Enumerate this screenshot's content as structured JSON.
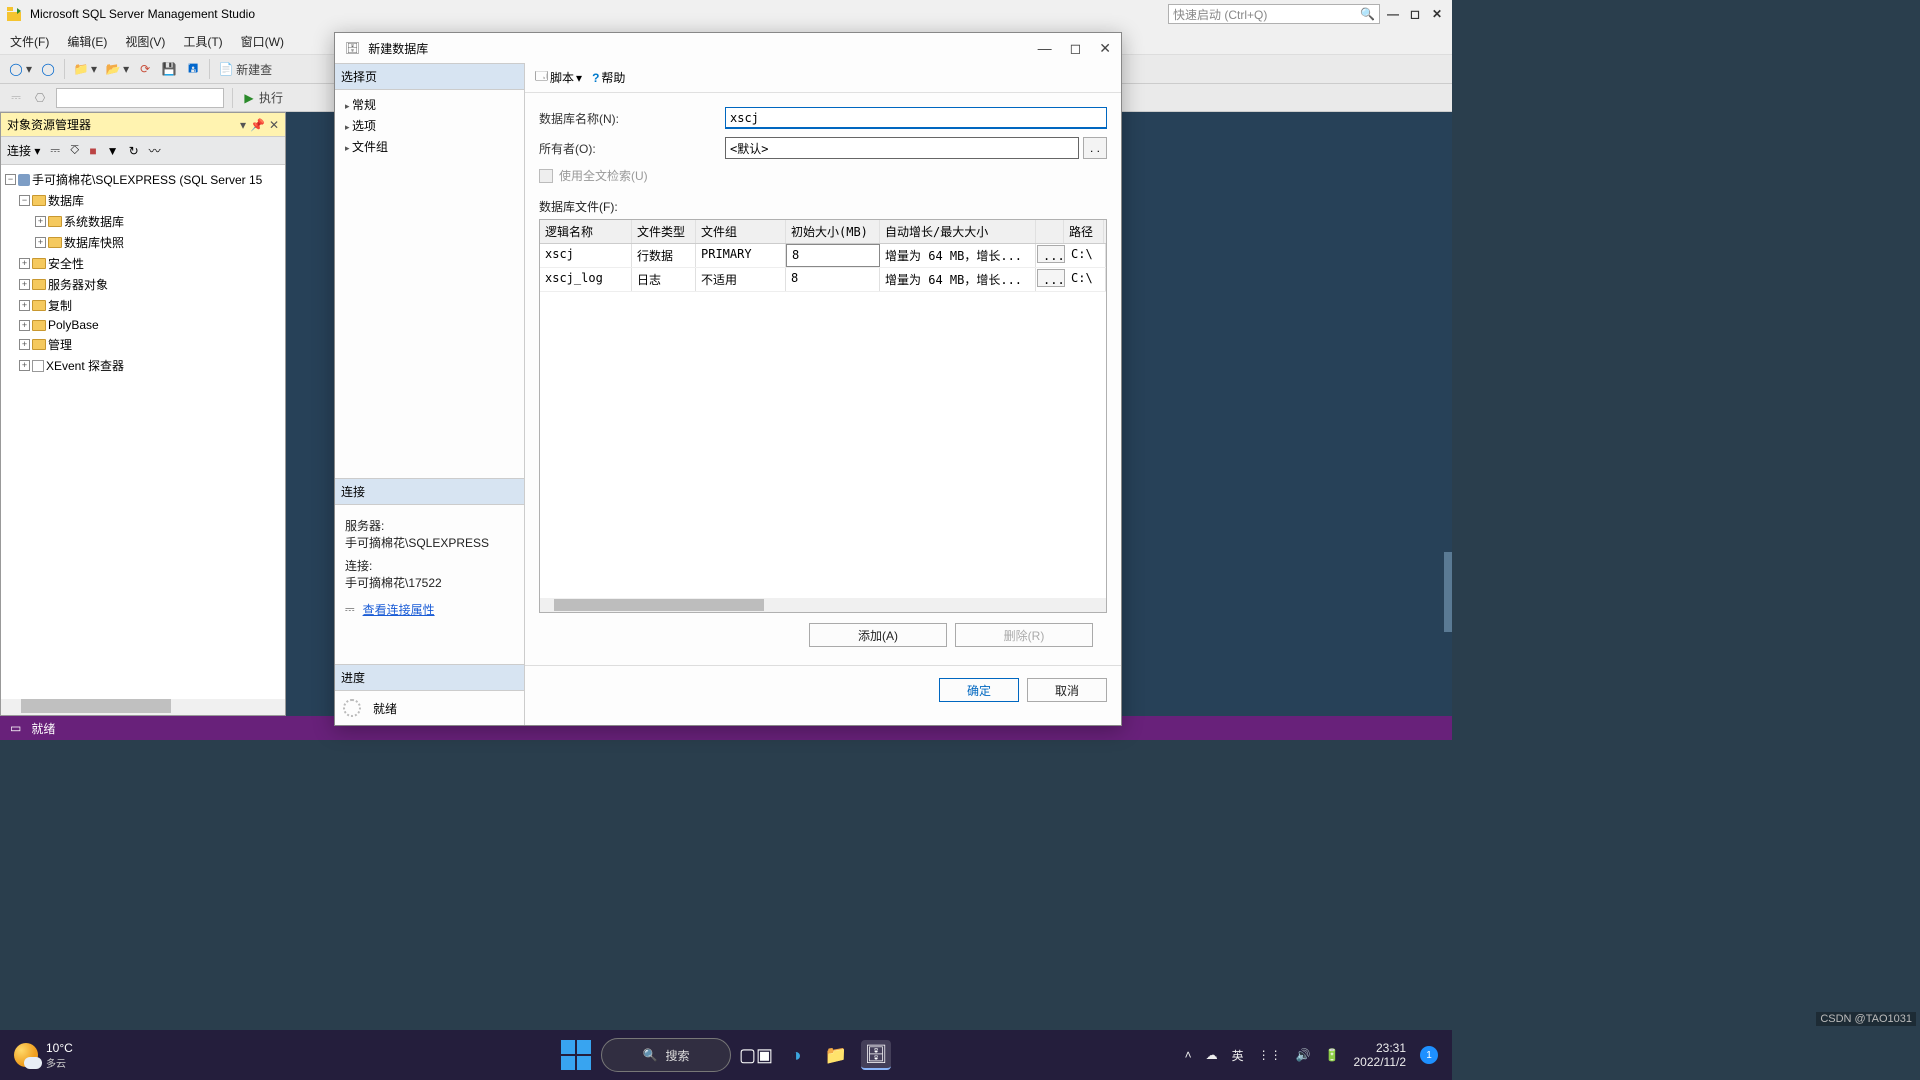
{
  "app": {
    "title": "Microsoft SQL Server Management Studio",
    "quick_launch_placeholder": "快速启动 (Ctrl+Q)"
  },
  "menu": {
    "file": "文件(F)",
    "edit": "编辑(E)",
    "view": "视图(V)",
    "tools": "工具(T)",
    "window": "窗口(W)"
  },
  "toolbar": {
    "new": "新建查",
    "execute": "执行"
  },
  "explorer": {
    "title": "对象资源管理器",
    "connect": "连接",
    "root": "手可摘棉花\\SQLEXPRESS (SQL Server 15",
    "databases": "数据库",
    "sys_db": "系统数据库",
    "snapshot": "数据库快照",
    "security": "安全性",
    "server_obj": "服务器对象",
    "replication": "复制",
    "polybase": "PolyBase",
    "management": "管理",
    "xevent": "XEvent 探查器"
  },
  "status": {
    "ready": "就绪"
  },
  "dialog": {
    "title": "新建数据库",
    "select_page": "选择页",
    "pages": {
      "general": "常规",
      "options": "选项",
      "filegroups": "文件组"
    },
    "script": "脚本",
    "help": "帮助",
    "db_name_label": "数据库名称(N):",
    "db_name_value": "xscj",
    "owner_label": "所有者(O):",
    "owner_value": "<默认>",
    "fulltext": "使用全文检索(U)",
    "files_label": "数据库文件(F):",
    "columns": {
      "logical": "逻辑名称",
      "type": "文件类型",
      "group": "文件组",
      "size": "初始大小(MB)",
      "growth": "自动增长/最大大小",
      "path": "路径"
    },
    "rows": [
      {
        "name": "xscj",
        "type": "行数据",
        "group": "PRIMARY",
        "size": "8",
        "growth": "增量为 64 MB，增长...",
        "path": "C:\\"
      },
      {
        "name": "xscj_log",
        "type": "日志",
        "group": "不适用",
        "size": "8",
        "growth": "增量为 64 MB，增长...",
        "path": "C:\\"
      }
    ],
    "add": "添加(A)",
    "remove": "删除(R)",
    "ok": "确定",
    "cancel": "取消",
    "connection": "连接",
    "server_lbl": "服务器:",
    "server_val": "手可摘棉花\\SQLEXPRESS",
    "conn_lbl": "连接:",
    "conn_val": "手可摘棉花\\17522",
    "view_conn": "查看连接属性",
    "progress": "进度",
    "ready": "就绪",
    "browse": ". ."
  },
  "taskbar": {
    "temp": "10°C",
    "weather": "多云",
    "search": "搜索",
    "ime": "英",
    "time": "23:31",
    "date": "2022/11/2",
    "notif": "1"
  },
  "watermark": "CSDN @TAO1031"
}
